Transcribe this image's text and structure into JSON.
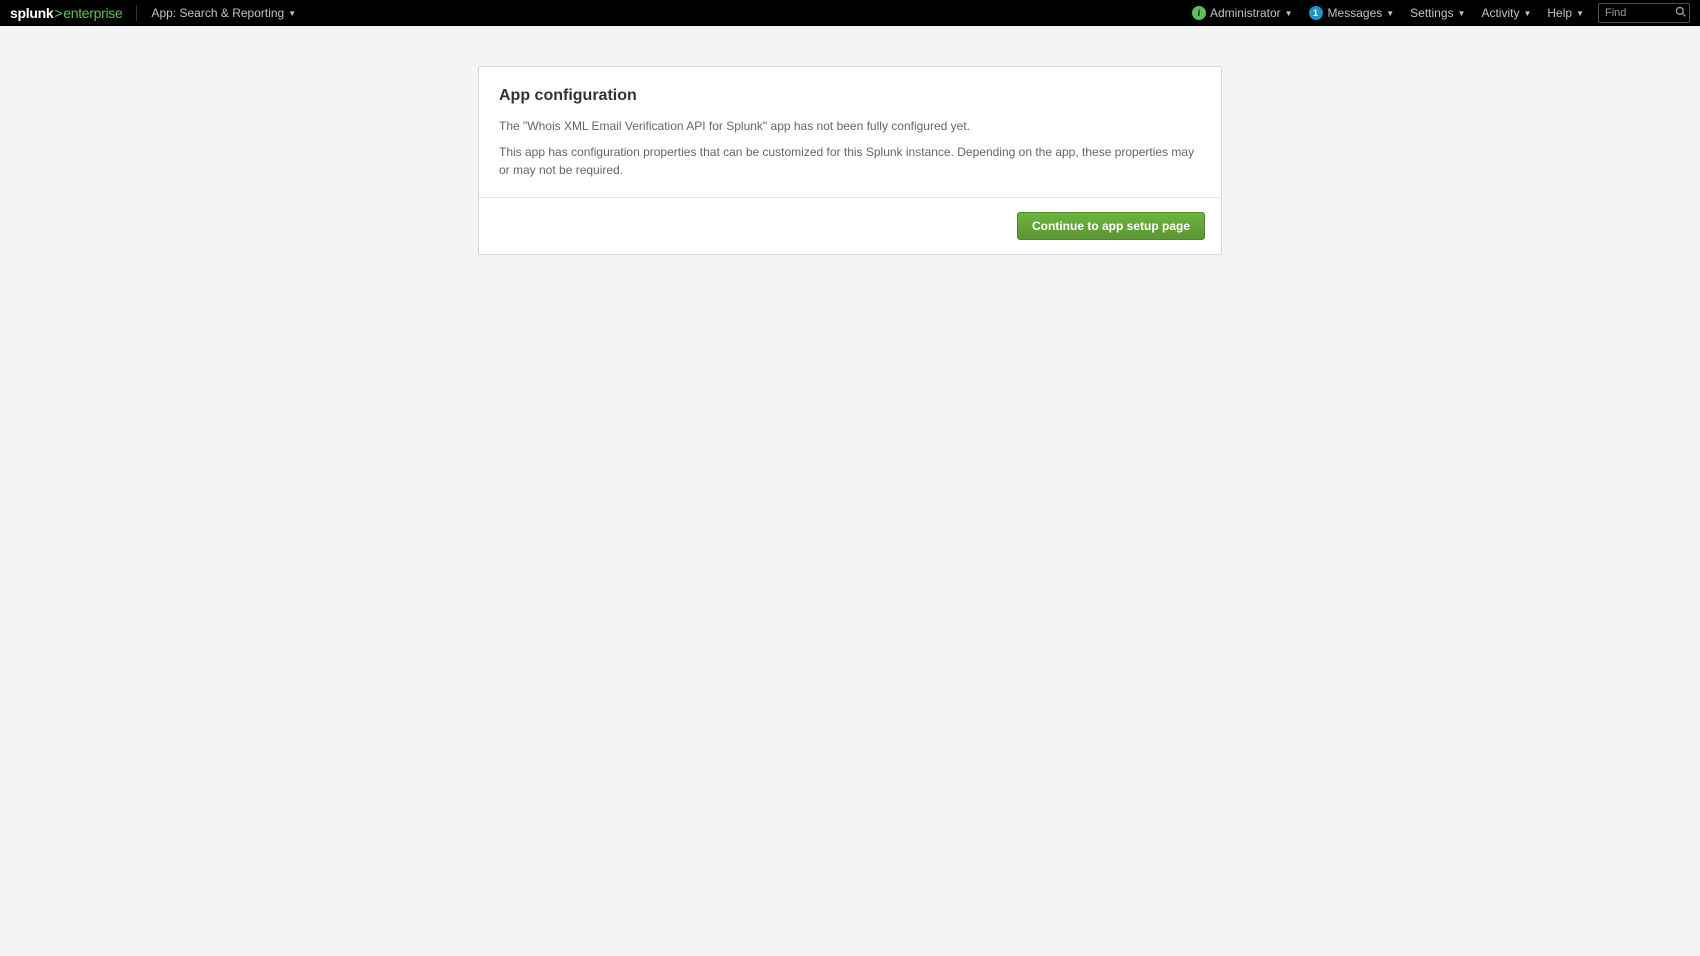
{
  "logo": {
    "splunk": "splunk",
    "gt": ">",
    "ent": "enterprise"
  },
  "nav": {
    "app_label": "App: Search & Reporting",
    "administrator": "Administrator",
    "messages": "Messages",
    "messages_count": "1",
    "settings": "Settings",
    "activity": "Activity",
    "help": "Help",
    "find_placeholder": "Find"
  },
  "panel": {
    "title": "App configuration",
    "line1": "The \"Whois XML Email Verification API for Splunk\" app has not been fully configured yet.",
    "line2": "This app has configuration properties that can be customized for this Splunk instance. Depending on the app, these properties may or may not be required.",
    "button": "Continue to app setup page"
  }
}
